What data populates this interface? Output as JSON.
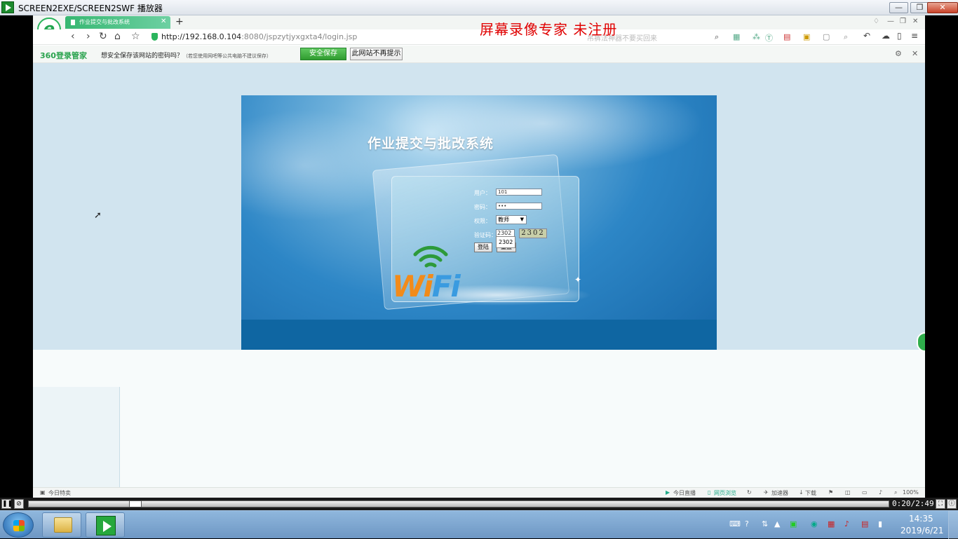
{
  "player": {
    "window_title": "SCREEN2EXE/SCREEN2SWF 播放器",
    "time": "0:20/2:49",
    "progress_fraction": 0.119
  },
  "watermark": "屏幕录像专家  未注册",
  "browser": {
    "tab_title": "作业提交与批改系统",
    "new_tab": "+",
    "url_host": "http://192.168.0.104",
    "url_path": ":8080/jspzytjyxgxta4/login.jsp",
    "search_placeholder": "吊裤法神器不要买回来"
  },
  "password_bar": {
    "brand": "360登录管家",
    "message": "想安全保存该网站的密码吗？",
    "hint": "（若您使用网吧等公共电脑不建议保存）",
    "save_button": "安全保存",
    "never_button": "此网站不再提示"
  },
  "login": {
    "system_title": "作业提交与批改系统",
    "user_label": "用户：",
    "user_value": "101",
    "password_label": "密码：",
    "password_value": "•••",
    "role_label": "权限：",
    "role_selected": "教师",
    "captcha_label": "验证码：",
    "captcha_input": "2302",
    "captcha_image_text": "2302",
    "autocomplete_suggestion": "2302",
    "login_button": "登陆",
    "reset_button": "重置",
    "logo_text": "WiFi"
  },
  "statusbar": {
    "left_item": "今日特卖",
    "items": [
      "今日直播",
      "网页浏览",
      "加速器",
      "下载"
    ],
    "zoom": "100%"
  },
  "taskbar": {
    "clock_time": "14:35",
    "clock_date": "2019/6/21"
  },
  "colors": {
    "accent_green": "#2bb55d",
    "watermark_red": "#e00000",
    "banner_blue": "#2d86c6"
  }
}
